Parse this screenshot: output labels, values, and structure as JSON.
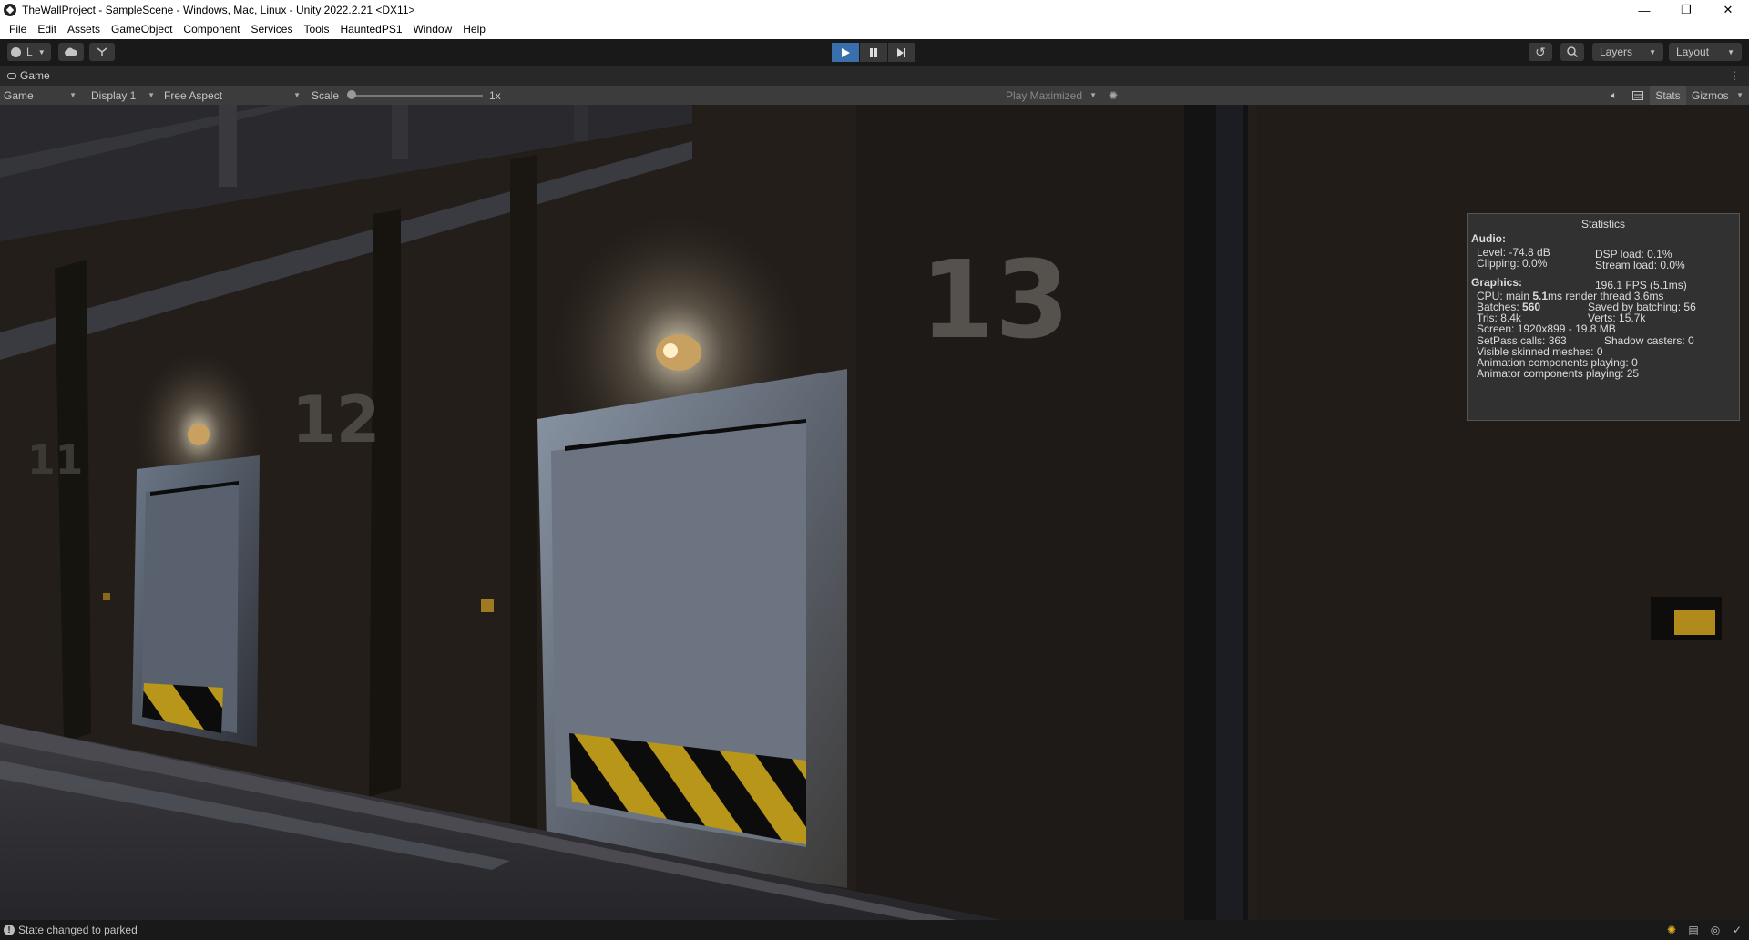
{
  "window": {
    "title": "TheWallProject - SampleScene - Windows, Mac, Linux - Unity 2022.2.21 <DX11>",
    "minimize_glyph": "—",
    "maximize_glyph": "❐",
    "close_glyph": "✕"
  },
  "menu": [
    "File",
    "Edit",
    "Assets",
    "GameObject",
    "Component",
    "Services",
    "Tools",
    "HauntedPS1",
    "Window",
    "Help"
  ],
  "toolbar": {
    "account_label": "L",
    "layers_label": "Layers",
    "layout_label": "Layout",
    "play_state": "playing"
  },
  "game_tab": {
    "label": "Game"
  },
  "game_controls": {
    "view_mode": "Game",
    "display": "Display 1",
    "aspect": "Free Aspect",
    "scale_label": "Scale",
    "scale_value": "1x",
    "scale_fraction": 0.0,
    "play_mode": "Play Maximized",
    "stats_label": "Stats",
    "gizmos_label": "Gizmos"
  },
  "scene": {
    "wall_numbers": [
      "11",
      "12",
      "13"
    ]
  },
  "stats": {
    "title": "Statistics",
    "audio_header": "Audio:",
    "level": "Level: -74.8 dB",
    "clipping": "Clipping: 0.0%",
    "dsp_load": "DSP load: 0.1%",
    "stream_load": "Stream load: 0.0%",
    "graphics_header": "Graphics:",
    "fps": "196.1 FPS (5.1ms)",
    "cpu_prefix": "CPU: main",
    "cpu_main": "5.1",
    "cpu_suffix": "ms  render thread 3.6ms",
    "batches_prefix": "Batches:",
    "batches": "560",
    "saved_batching": "Saved by batching: 56",
    "tris": "Tris: 8.4k",
    "verts": "Verts: 15.7k",
    "screen": "Screen: 1920x899 - 19.8 MB",
    "setpass": "SetPass calls: 363",
    "shadow_casters": "Shadow casters: 0",
    "skinned": "Visible skinned meshes: 0",
    "animation": "Animation components playing: 0",
    "animator": "Animator components playing: 25"
  },
  "status": {
    "message": "State changed to parked"
  },
  "colors": {
    "play_active": "#3a6fae",
    "editor_bg": "#191919",
    "panel_bg": "#3c3c3c",
    "hazard_yellow": "#b8961a"
  }
}
